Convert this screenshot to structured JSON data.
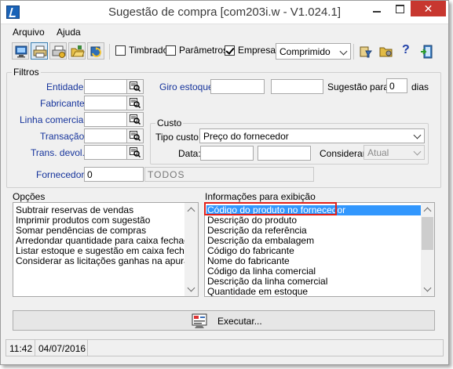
{
  "window": {
    "title": "Sugestão de compra [com203i.w - V1.024.1]",
    "close_glyph": "✕"
  },
  "menu": {
    "items": [
      "Arquivo",
      "Ajuda"
    ]
  },
  "toolbar": {
    "tools": [
      "monitor-icon",
      "printer-icon",
      "printer-setup-icon",
      "open-folder-icon",
      "refresh-icon"
    ],
    "checkboxes": [
      {
        "label": "Timbrado",
        "checked": false
      },
      {
        "label": "Parâmetros",
        "checked": false
      },
      {
        "label": "Empresa",
        "checked": true
      }
    ],
    "format_select": {
      "value": "Comprimido"
    },
    "right_tools": [
      "filter-icon",
      "folder-tools-icon",
      "help-icon",
      "exit-icon"
    ],
    "help_glyph": "?"
  },
  "filtros": {
    "title": "Filtros",
    "entidade_label": "Entidade:",
    "fabricante_label": "Fabricante:",
    "linha_label": "Linha comercial:",
    "transacao_label": "Transação:",
    "trans_devol_label": "Trans. devol.:",
    "giro_label": "Giro estoque:",
    "sugestao_label": "Sugestão para:",
    "sugestao_value": "0",
    "dias_label": "dias",
    "fornecedor_label": "Fornecedor:",
    "fornecedor_value": "0",
    "fornecedor_desc": "TODOS"
  },
  "custo": {
    "title": "Custo",
    "tipo_label": "Tipo custo:",
    "tipo_value": "Preço do fornecedor",
    "data_label": "Data:",
    "considerar_label": "Considerar:",
    "considerar_value": "Atual"
  },
  "opcoes": {
    "title": "Opções",
    "items": [
      "Subtrair reservas de vendas",
      "Imprimir produtos com sugestão",
      "Somar pendências de compras",
      "Arredondar quantidade para caixa fechada",
      "Listar estoque e sugestão em caixa fechada",
      "Considerar as licitações ganhas na apuração"
    ]
  },
  "info": {
    "title": "Informações para exibição",
    "items": [
      "Código do produto no fornecedor",
      "Descrição do produto",
      "Descrição da referência",
      "Descrição da embalagem",
      "Código do fabricante",
      "Nome do fabricante",
      "Código da linha comercial",
      "Descrição da linha comercial",
      "Quantidade em estoque"
    ],
    "selected_index": 0
  },
  "execute": {
    "label": "Executar..."
  },
  "status": {
    "time": "11:42",
    "date": "04/07/2016"
  },
  "colors": {
    "selection": "#3297fd",
    "highlight": "#e0211b",
    "label_blue": "#16349c"
  }
}
